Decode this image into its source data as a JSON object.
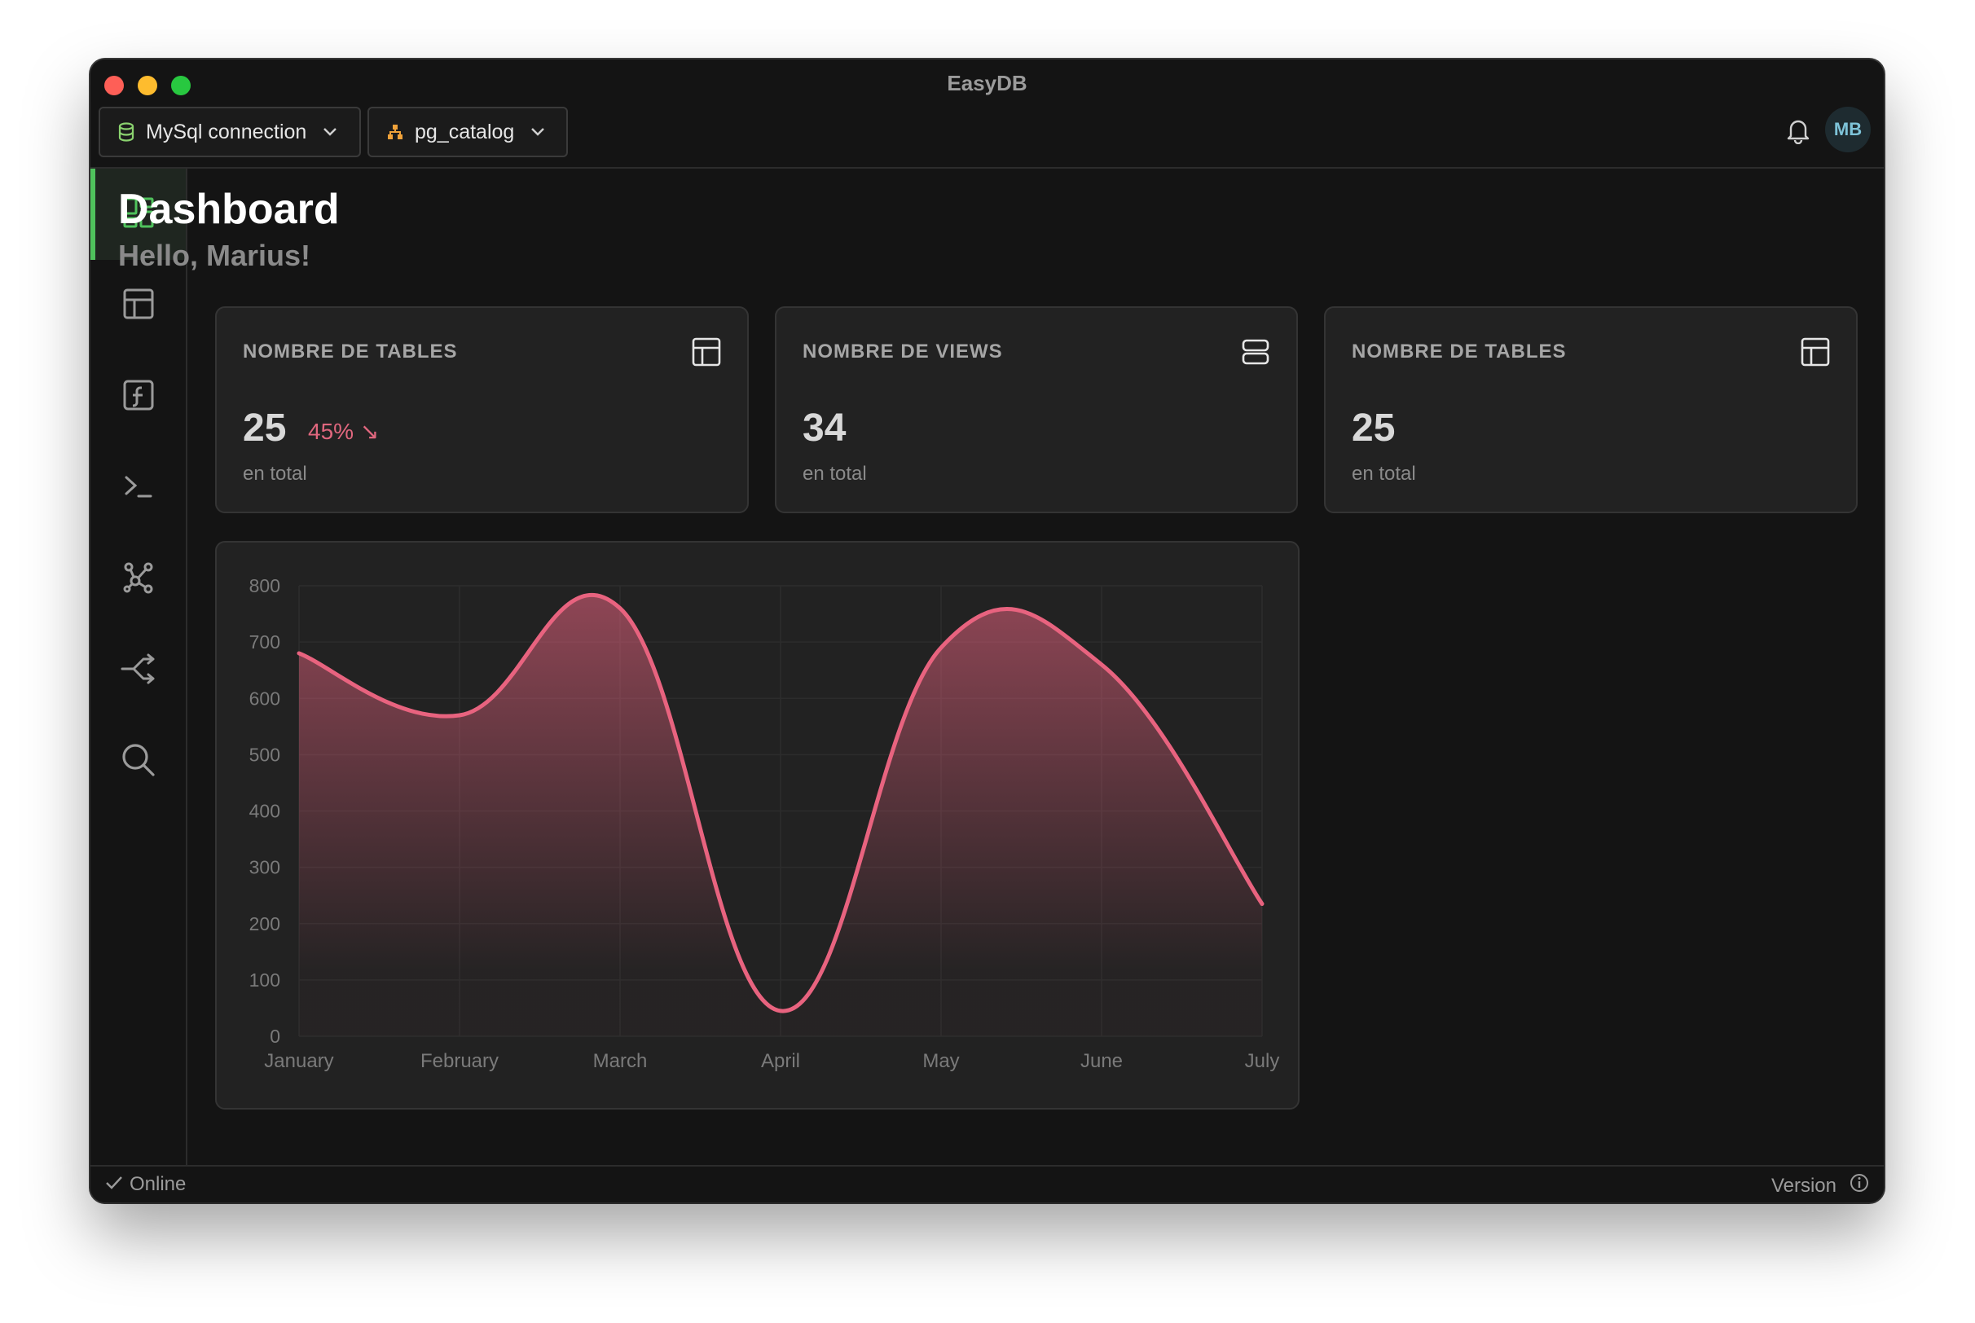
{
  "app": {
    "title": "EasyDB"
  },
  "toolbar": {
    "connection": {
      "label": "MySql connection",
      "icon": "database-icon",
      "color": "#8bd36f"
    },
    "schema": {
      "label": "pg_catalog",
      "icon": "schema-tree-icon",
      "color": "#f0a23a"
    },
    "notifications_icon": "bell-icon",
    "avatar": "MB"
  },
  "sidebar": {
    "items": [
      {
        "name": "dashboard",
        "icon": "dashboard-icon",
        "active": true
      },
      {
        "name": "tables",
        "icon": "table-icon",
        "active": false
      },
      {
        "name": "functions",
        "icon": "function-icon",
        "active": false
      },
      {
        "name": "terminal",
        "icon": "terminal-icon",
        "active": false
      },
      {
        "name": "relations",
        "icon": "graph-icon",
        "active": false
      },
      {
        "name": "migrations",
        "icon": "merge-icon",
        "active": false
      },
      {
        "name": "search",
        "icon": "search-icon",
        "active": false
      }
    ],
    "accent": "#4fc25c"
  },
  "main": {
    "title": "Dashboard",
    "greeting": "Hello, Marius!",
    "cards": [
      {
        "label": "NOMBRE DE TABLES",
        "value": "25",
        "delta": "45% ↘",
        "sub": "en total",
        "icon": "table-icon"
      },
      {
        "label": "NOMBRE DE VIEWS",
        "value": "34",
        "sub": "en total",
        "icon": "views-icon"
      },
      {
        "label": "NOMBRE DE TABLES",
        "value": "25",
        "sub": "en total",
        "icon": "table-icon"
      }
    ]
  },
  "chart_data": {
    "type": "area",
    "categories": [
      "January",
      "February",
      "March",
      "April",
      "May",
      "June",
      "July"
    ],
    "values": [
      680,
      570,
      760,
      45,
      690,
      660,
      235
    ],
    "ylim": [
      0,
      800
    ],
    "yticks": [
      0,
      100,
      200,
      300,
      400,
      500,
      600,
      700,
      800
    ],
    "grid": true,
    "color": "#e8637f"
  },
  "statusbar": {
    "status": "Online",
    "version_label": "Version"
  }
}
